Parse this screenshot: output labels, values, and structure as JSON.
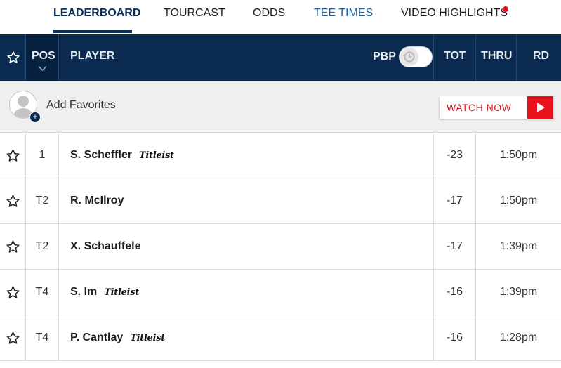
{
  "tabs": [
    {
      "label": "LEADERBOARD"
    },
    {
      "label": "TOURCAST"
    },
    {
      "label": "ODDS"
    },
    {
      "label": "TEE TIMES"
    },
    {
      "label": "VIDEO HIGHLIGHTS"
    }
  ],
  "header": {
    "pos": "POS",
    "player": "PLAYER",
    "pbp": "PBP",
    "tot": "TOT",
    "thru": "THRU",
    "rd": "RD"
  },
  "favorites": {
    "add_label": "Add Favorites",
    "plus": "+",
    "watch_label": "WATCH NOW"
  },
  "rows": [
    {
      "pos": "1",
      "name": "S. Scheffler",
      "sponsor": "Titleist",
      "tot": "-23",
      "thru": "1:50pm"
    },
    {
      "pos": "T2",
      "name": "R. McIlroy",
      "sponsor": "",
      "tot": "-17",
      "thru": "1:50pm"
    },
    {
      "pos": "T2",
      "name": "X. Schauffele",
      "sponsor": "",
      "tot": "-17",
      "thru": "1:39pm"
    },
    {
      "pos": "T4",
      "name": "S. Im",
      "sponsor": "Titleist",
      "tot": "-16",
      "thru": "1:39pm"
    },
    {
      "pos": "T4",
      "name": "P. Cantlay",
      "sponsor": "Titleist",
      "tot": "-16",
      "thru": "1:28pm"
    }
  ],
  "colors": {
    "navy": "#0a2a4f",
    "accent_red": "#e8111c",
    "tee_times_blue": "#1d5e9c"
  },
  "icons": [
    "star-outline-icon",
    "chevron-down-icon",
    "play-icon",
    "user-avatar-icon",
    "toggle-icon"
  ]
}
